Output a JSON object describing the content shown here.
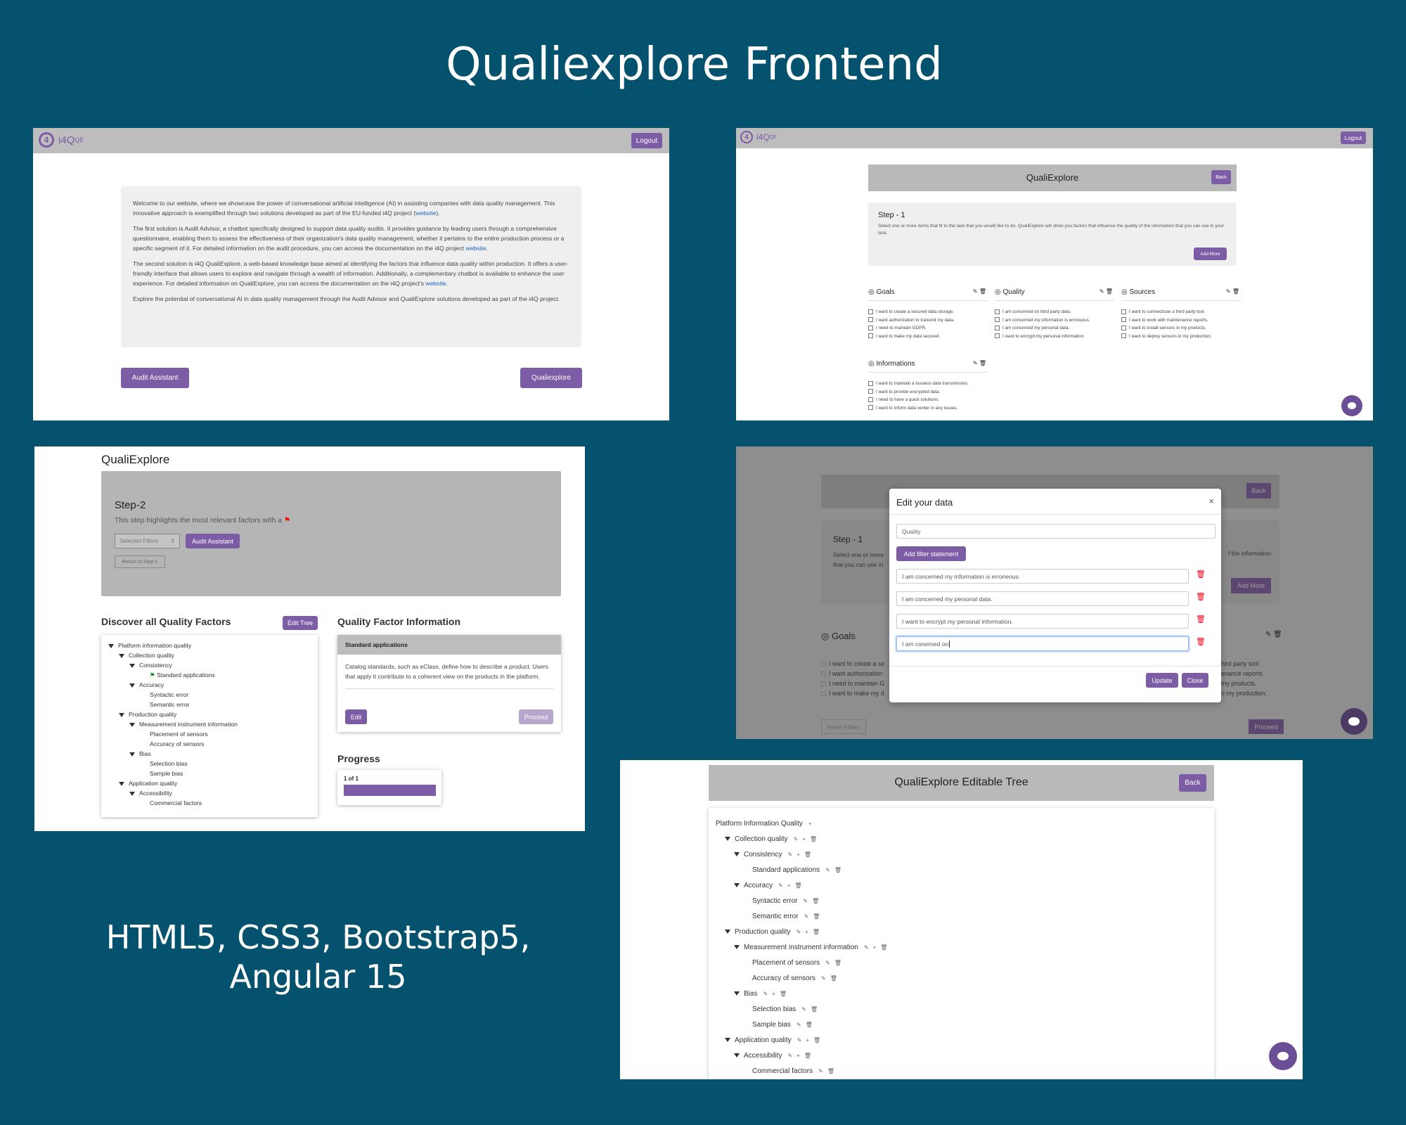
{
  "poster": {
    "title": "Qualiexplore Frontend",
    "tech_line1": "HTML5, CSS3,  Bootstrap5,",
    "tech_line2": "Angular 15"
  },
  "shot1": {
    "logo": "i4Q",
    "logo_sup": "QE",
    "logout": "Logout",
    "para1a": "Welcome to our website, where we showcase the power of conversational artificial intelligence (AI) in assisting companies with data quality management. This innovative approach is exemplified through two solutions developed as part of the EU-funded i4Q project (",
    "para1_link": "website",
    "para1b": ").",
    "para2a": "The first solution is Audit Advisor, a chatbot specifically designed to support data quality audits. It provides guidance by leading users through a comprehensive questionnaire, enabling them to assess the effectiveness of their organization's data quality management, whether it pertains to the entire production process or a specific segment of it. For detailed information on the audit procedure, you can access the documentation on the i4Q project ",
    "para2_link": "website",
    "para2b": ".",
    "para3a": "The second solution is i4Q QualiExplore, a web-based knowledge base aimed at identifying the factors that influence data quality within production. It offers a user-friendly interface that allows users to explore and navigate through a wealth of information. Additionally, a complementary chatbot is available to enhance the user experience. For detailed information on QualiExplore, you can access the documentation on the i4Q project's ",
    "para3_link": "website",
    "para3b": ".",
    "para4": "Explore the potential of conversational AI in data quality management through the Audit Advisor and QualiExplore solutions developed as part of the i4Q project.",
    "btn_audit": "Audit Assistant",
    "btn_quali": "Qualiexplore"
  },
  "shot2": {
    "logo": "i4Q",
    "logo_sup": "QE",
    "logout": "Logout",
    "header": "QualiExplore",
    "back": "Back",
    "step_title": "Step - 1",
    "step_text": "Select one or more items that fit to the task that you would like to do. QualiExplore will show you factors that influence the quality of the information that you can use in your task.",
    "add_more": "Add More",
    "goals_title": "Goals",
    "goals": [
      "I want to create a secured data storage.",
      "I want authorization to transmit my data.",
      "I need to maintain GDPR.",
      "I want to make my data secured."
    ],
    "quality_title": "Quality",
    "quality": [
      "I am concerned on third party data.",
      "I am concerned my information is erroneous.",
      "I am concerned my personal data.",
      "I want to encrypt my personal information."
    ],
    "sources_title": "Sources",
    "sources": [
      "I want to connect/use a third party tool.",
      "I want to work with maintenance reports.",
      "I want to install sensors in my products.",
      "I want to deploy sensors in my production."
    ],
    "info_title": "Informations",
    "info": [
      "I want to maintain a lossless data transmission.",
      "I want to provide encrypted data.",
      "I need to have a quick solutions.",
      "I want to inform data center in any issues."
    ]
  },
  "shot3": {
    "header": "QualiExplore",
    "step_title": "Step-2",
    "step_text": "This step highlights the most relevant factors with a",
    "filters": "Selected Filters",
    "audit": "Audit Assistant",
    "return": "Return to Step-1",
    "discover_title": "Discover all Quality Factors",
    "edit_tree": "Edit Tree",
    "tree": [
      {
        "label": "Platform information quality",
        "level": 0,
        "caret": true
      },
      {
        "label": "Collection quality",
        "level": 1,
        "caret": true
      },
      {
        "label": "Consistency",
        "level": 2,
        "caret": true
      },
      {
        "label": "Standard applications",
        "level": 3,
        "caret": false,
        "flag": true
      },
      {
        "label": "Accuracy",
        "level": 2,
        "caret": true
      },
      {
        "label": "Syntactic error",
        "level": 3,
        "caret": false
      },
      {
        "label": "Semantic error",
        "level": 3,
        "caret": false
      },
      {
        "label": "Production quality",
        "level": 1,
        "caret": true
      },
      {
        "label": "Measurement instrument information",
        "level": 2,
        "caret": true
      },
      {
        "label": "Placement of sensors",
        "level": 3,
        "caret": false
      },
      {
        "label": "Accuracy of sensors",
        "level": 3,
        "caret": false
      },
      {
        "label": "Bias",
        "level": 2,
        "caret": true
      },
      {
        "label": "Selection bias",
        "level": 3,
        "caret": false
      },
      {
        "label": "Sample bias",
        "level": 3,
        "caret": false
      },
      {
        "label": "Application quality",
        "level": 1,
        "caret": true
      },
      {
        "label": "Accessibility",
        "level": 2,
        "caret": true
      },
      {
        "label": "Commercial factors",
        "level": 3,
        "caret": false
      }
    ],
    "info_title": "Quality Factor Information",
    "card_header": "Standard applications",
    "card_text": "Catalog standards, such as eClass, define how to describe a product. Users that apply it contribute to a coherent view on the products in the platform.",
    "edit": "Edit",
    "proceed": "Proceed",
    "progress_title": "Progress",
    "progress_text": "1 of 1",
    "progress_value": 1.0
  },
  "shot4": {
    "bg_back": "Back",
    "bg_step": "Step - 1",
    "bg_step_text1": "Select one or more",
    "bg_step_text2": "that you can use in",
    "bg_step_right": "f the information",
    "bg_add_more": "Add More",
    "bg_goals": "Goals",
    "bg_goal_items": [
      "I want to create a se",
      "I want authorization",
      "I need to maintain G",
      "I want to make my d"
    ],
    "bg_right_items": [
      "hird party tool.",
      "enance reports.",
      "my products.",
      "n my production."
    ],
    "bg_reset": "Reset Filters",
    "bg_proceed": "Proceed",
    "modal_title": "Edit your data",
    "close_x": "×",
    "category": "Quality",
    "add_filter": "Add filter statement",
    "statements": [
      "I am concerned my information is erroneous.",
      "I am concerned my personal data.",
      "I want to encrypt my personal information.",
      "I am conerned on"
    ],
    "update": "Update",
    "close": "Close"
  },
  "shot5": {
    "header": "QualiExplore Editable Tree",
    "back": "Back",
    "tree": [
      {
        "label": "Platform Information Quality",
        "level": 0,
        "caret": false,
        "icons": "+"
      },
      {
        "label": "Collection quality",
        "level": 1,
        "caret": true,
        "icons": "edit-add-del"
      },
      {
        "label": "Consistency",
        "level": 2,
        "caret": true,
        "icons": "edit-add-del"
      },
      {
        "label": "Standard applications",
        "level": 3,
        "caret": false,
        "icons": "edit-del"
      },
      {
        "label": "Accuracy",
        "level": 2,
        "caret": true,
        "icons": "edit-add-del"
      },
      {
        "label": "Syntactic error",
        "level": 3,
        "caret": false,
        "icons": "edit-del"
      },
      {
        "label": "Semantic error",
        "level": 3,
        "caret": false,
        "icons": "edit-del"
      },
      {
        "label": "Production quality",
        "level": 1,
        "caret": true,
        "icons": "edit-add-del"
      },
      {
        "label": "Measurement instrument information",
        "level": 2,
        "caret": true,
        "icons": "edit-add-del"
      },
      {
        "label": "Placement of sensors",
        "level": 3,
        "caret": false,
        "icons": "edit-del"
      },
      {
        "label": "Accuracy of sensors",
        "level": 3,
        "caret": false,
        "icons": "edit-del"
      },
      {
        "label": "Bias",
        "level": 2,
        "caret": true,
        "icons": "edit-add-del"
      },
      {
        "label": "Selection bias",
        "level": 3,
        "caret": false,
        "icons": "edit-del"
      },
      {
        "label": "Sample bias",
        "level": 3,
        "caret": false,
        "icons": "edit-del"
      },
      {
        "label": "Application quality",
        "level": 1,
        "caret": true,
        "icons": "edit-add-del"
      },
      {
        "label": "Accessibility",
        "level": 2,
        "caret": true,
        "icons": "edit-add-del"
      },
      {
        "label": "Commercial factors",
        "level": 3,
        "caret": false,
        "icons": "edit-del"
      }
    ]
  }
}
